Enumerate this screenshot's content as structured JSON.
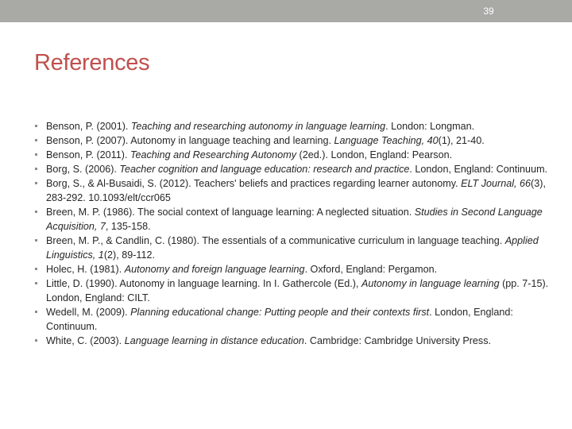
{
  "slide": {
    "page_number": "39",
    "title": "References",
    "accent_color": "#c0504d",
    "topbar_color": "#a9aaa5"
  },
  "references": [
    {
      "parts": [
        {
          "t": "Benson, P. (2001). "
        },
        {
          "t": "Teaching and researching autonomy in language learning",
          "i": true
        },
        {
          "t": ". London: Longman."
        }
      ]
    },
    {
      "parts": [
        {
          "t": "Benson, P. (2007). Autonomy in language teaching and learning. "
        },
        {
          "t": "Language Teaching, 40",
          "i": true
        },
        {
          "t": "(1), 21-40."
        }
      ]
    },
    {
      "parts": [
        {
          "t": "Benson, P. (2011). "
        },
        {
          "t": "Teaching and Researching Autonomy",
          "i": true
        },
        {
          "t": " (2ed.). London, England: Pearson."
        }
      ]
    },
    {
      "parts": [
        {
          "t": "Borg, S. (2006). "
        },
        {
          "t": "Teacher cognition and language education: research and practice",
          "i": true
        },
        {
          "t": ". London, England: Continuum."
        }
      ]
    },
    {
      "parts": [
        {
          "t": "Borg, S., & Al-Busaidi, S. (2012). Teachers' beliefs and practices regarding learner autonomy. "
        },
        {
          "t": "ELT Journal, 66",
          "i": true
        },
        {
          "t": "(3), 283-292. 10.1093/elt/ccr065"
        }
      ]
    },
    {
      "parts": [
        {
          "t": "Breen, M. P. (1986). The social context of language learning: A neglected situation. "
        },
        {
          "t": "Studies in Second Language Acquisition, 7",
          "i": true
        },
        {
          "t": ", 135-158."
        }
      ]
    },
    {
      "parts": [
        {
          "t": "Breen, M. P., & Candlin, C. (1980). The essentials of a communicative curriculum in language teaching. "
        },
        {
          "t": "Applied Linguistics, 1",
          "i": true
        },
        {
          "t": "(2), 89-112."
        }
      ]
    },
    {
      "parts": [
        {
          "t": "Holec, H. (1981). "
        },
        {
          "t": "Autonomy and foreign language learning",
          "i": true
        },
        {
          "t": ". Oxford, England: Pergamon."
        }
      ]
    },
    {
      "parts": [
        {
          "t": "Little, D. (1990). Autonomy in language learning. In I. Gathercole (Ed.), "
        },
        {
          "t": "Autonomy in language learning",
          "i": true
        },
        {
          "t": " (pp. 7-15). London, England: CILT."
        }
      ]
    },
    {
      "parts": [
        {
          "t": "Wedell, M. (2009). "
        },
        {
          "t": "Planning educational change: Putting people and their contexts first",
          "i": true
        },
        {
          "t": ". London, England: Continuum."
        }
      ]
    },
    {
      "parts": [
        {
          "t": "White, C. (2003). "
        },
        {
          "t": "Language learning in distance education",
          "i": true
        },
        {
          "t": ". Cambridge: Cambridge University Press."
        }
      ]
    }
  ]
}
